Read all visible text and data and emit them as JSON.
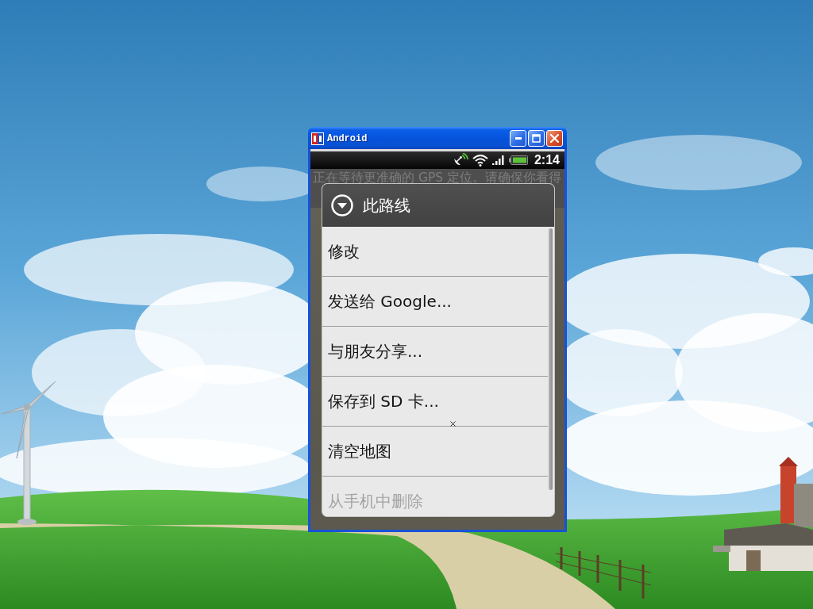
{
  "window": {
    "title": "Android",
    "controls": [
      {
        "kind": "minimize"
      },
      {
        "kind": "maximize"
      },
      {
        "kind": "close"
      }
    ]
  },
  "status_bar": {
    "time": "2:14"
  },
  "banner": {
    "text": "正在等待更准确的 GPS 定位。请确保你看得"
  },
  "dialog": {
    "title": "此路线",
    "items": [
      {
        "label": "修改"
      },
      {
        "label": "发送给 Google..."
      },
      {
        "label": "与朋友分享..."
      },
      {
        "label": "保存到 SD 卡..."
      },
      {
        "label": "清空地图"
      },
      {
        "label": "从手机中删除"
      }
    ]
  }
}
